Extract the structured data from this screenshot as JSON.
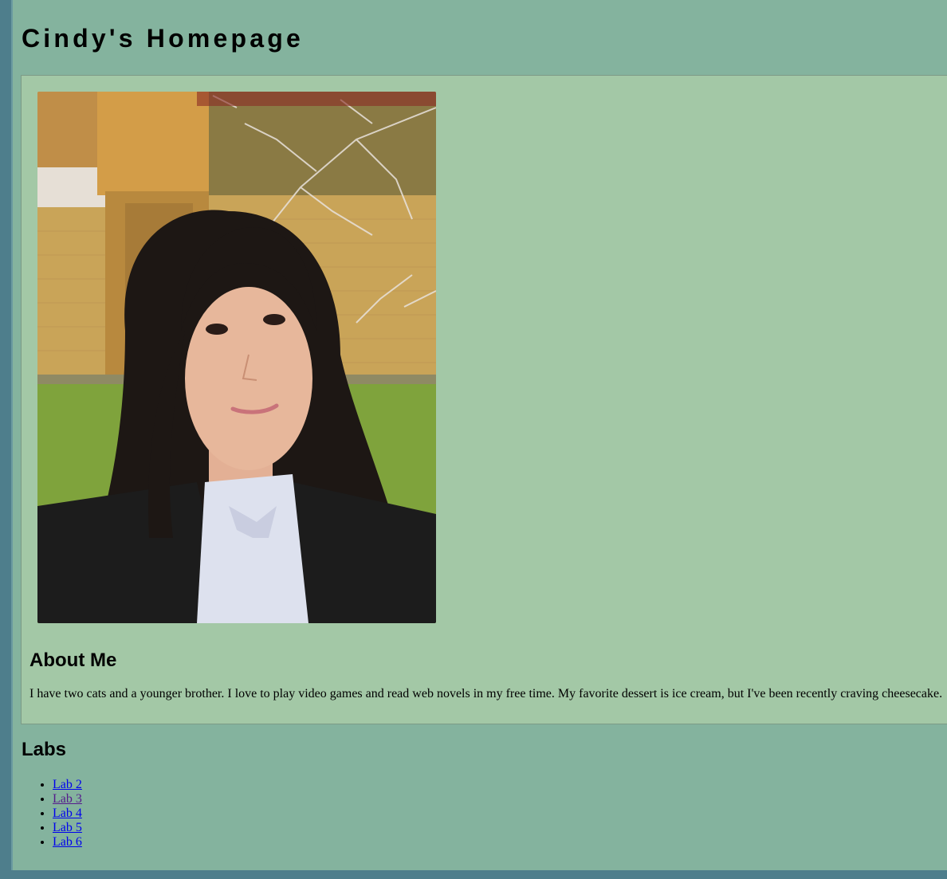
{
  "header": {
    "title": "Cindy's Homepage"
  },
  "about": {
    "heading": "About Me",
    "text": "I have two cats and a younger brother. I love to play video games and read web novels in my free time. My favorite dessert is ice cream, but I've been recently craving cheesecake."
  },
  "labs": {
    "heading": "Labs",
    "items": [
      {
        "label": "Lab 2",
        "visited": false
      },
      {
        "label": "Lab 3",
        "visited": true
      },
      {
        "label": "Lab 4",
        "visited": false
      },
      {
        "label": "Lab 5",
        "visited": false
      },
      {
        "label": "Lab 6",
        "visited": false
      }
    ]
  },
  "colors": {
    "page_bg": "#84b39e",
    "card_bg": "#a3c8a6",
    "frame": "#4e7e8c",
    "link": "#0000ee",
    "link_visited": "#551a8b"
  }
}
